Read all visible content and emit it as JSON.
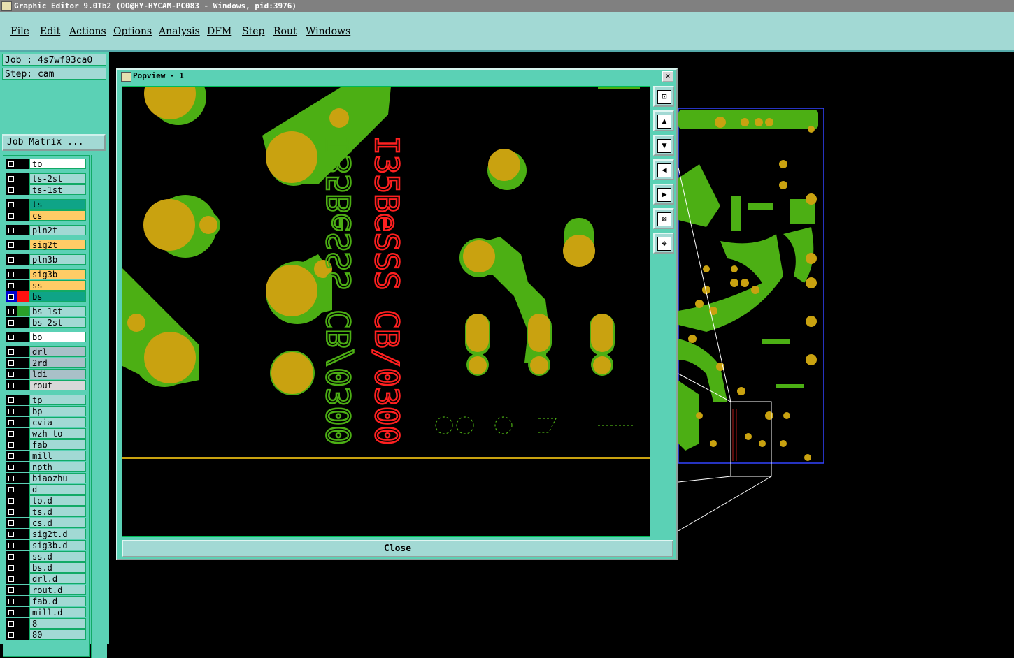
{
  "window": {
    "title": "Graphic Editor 9.0Tb2 (OO@HY-HYCAM-PC083 - Windows, pid:3976)"
  },
  "menu": [
    "File",
    "Edit",
    "Actions",
    "Options",
    "Analysis",
    "DFM",
    "Step",
    "Rout",
    "Windows"
  ],
  "job": {
    "label": "Job : 4s7wf03ca0",
    "step": "Step: cam",
    "matrix_button": "Job Matrix ..."
  },
  "layers": [
    {
      "name": "to",
      "color": "#ffffff"
    },
    {
      "name": "ts-2st",
      "color": "#a2d9d4"
    },
    {
      "name": "ts-1st",
      "color": "#a2d9d4"
    },
    {
      "name": "ts",
      "color": "#0fa487"
    },
    {
      "name": "cs",
      "color": "#ffcc66"
    },
    {
      "name": "pln2t",
      "color": "#a2d9d4"
    },
    {
      "name": "sig2t",
      "color": "#ffcc66"
    },
    {
      "name": "pln3b",
      "color": "#a2d9d4"
    },
    {
      "name": "sig3b",
      "color": "#ffcc66"
    },
    {
      "name": "ss",
      "color": "#ffcc66"
    },
    {
      "name": "bs",
      "color": "#0fa487"
    },
    {
      "name": "bs-1st",
      "color": "#a2d9d4"
    },
    {
      "name": "bs-2st",
      "color": "#a2d9d4"
    },
    {
      "name": "bo",
      "color": "#ffffff"
    },
    {
      "name": "drl",
      "color": "#a9c0c8"
    },
    {
      "name": "2rd",
      "color": "#a9c0c8"
    },
    {
      "name": "ldi",
      "color": "#a9c0c8"
    },
    {
      "name": "rout",
      "color": "#d8d8d8"
    },
    {
      "name": "tp",
      "color": "#a2d9d4"
    },
    {
      "name": "bp",
      "color": "#a2d9d4"
    },
    {
      "name": "cvia",
      "color": "#a2d9d4"
    },
    {
      "name": "wzh-to",
      "color": "#a2d9d4"
    },
    {
      "name": "fab",
      "color": "#a2d9d4"
    },
    {
      "name": "mill",
      "color": "#a2d9d4"
    },
    {
      "name": "npth",
      "color": "#a2d9d4"
    },
    {
      "name": "biaozhu",
      "color": "#a2d9d4"
    },
    {
      "name": "d",
      "color": "#a2d9d4"
    },
    {
      "name": "to.d",
      "color": "#a2d9d4"
    },
    {
      "name": "ts.d",
      "color": "#a2d9d4"
    },
    {
      "name": "cs.d",
      "color": "#a2d9d4"
    },
    {
      "name": "sig2t.d",
      "color": "#a2d9d4"
    },
    {
      "name": "sig3b.d",
      "color": "#a2d9d4"
    },
    {
      "name": "ss.d",
      "color": "#a2d9d4"
    },
    {
      "name": "bs.d",
      "color": "#a2d9d4"
    },
    {
      "name": "drl.d",
      "color": "#a2d9d4"
    },
    {
      "name": "rout.d",
      "color": "#a2d9d4"
    },
    {
      "name": "fab.d",
      "color": "#a2d9d4"
    },
    {
      "name": "mill.d",
      "color": "#a2d9d4"
    },
    {
      "name": "8",
      "color": "#a2d9d4"
    },
    {
      "name": "80",
      "color": "#a2d9d4"
    }
  ],
  "popview": {
    "title": "Popview - 1",
    "close_label": "Close",
    "text_red": "I35BeSSS CB/0300",
    "text_green": "I35BeSSS CB/0300"
  },
  "tools": [
    "zoom-fit-icon",
    "pan-up-icon",
    "pan-down-icon",
    "pan-left-icon",
    "pan-right-icon",
    "zoom-out-icon",
    "zoom-in-icon"
  ],
  "colors": {
    "copper": "#4caf14",
    "pad": "#c9a210",
    "silk_red": "#ff2020",
    "silk_green": "#4caf14",
    "panel": "#5bd1b5",
    "menu": "#a2d9d4"
  }
}
